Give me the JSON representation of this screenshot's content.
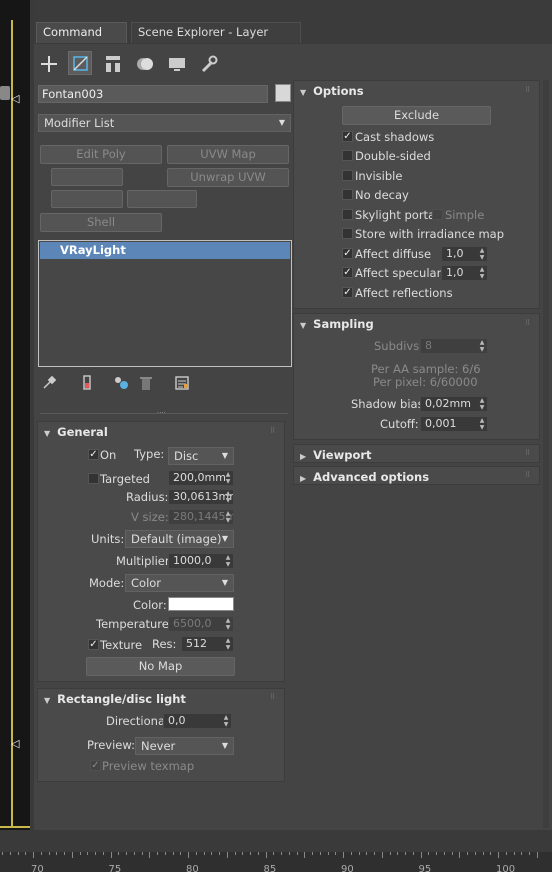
{
  "tabs": [
    {
      "label": "Command Panel"
    },
    {
      "label": "Scene Explorer - Layer Explorer"
    }
  ],
  "object": {
    "name": "Fontan003"
  },
  "modifier_list": {
    "value": "Modifier List"
  },
  "modifier_buttons": {
    "edit_poly": "Edit Poly",
    "uvw_map": "UVW Map",
    "unwrap_uvw": "Unwrap UVW",
    "shell": "Shell"
  },
  "stack": {
    "items": [
      {
        "label": "VRayLight"
      }
    ]
  },
  "general": {
    "title": "General",
    "on_label": "On",
    "type_label": "Type:",
    "type_value": "Disc",
    "targeted_label": "Targeted",
    "targeted_value": "200,0mm",
    "radius_label": "Radius:",
    "radius_value": "30,0613mm",
    "vsize_label": "V size:",
    "vsize_value": "280,1445mm",
    "units_label": "Units:",
    "units_value": "Default (image)",
    "multiplier_label": "Multiplier:",
    "multiplier_value": "1000,0",
    "mode_label": "Mode:",
    "mode_value": "Color",
    "color_label": "Color:",
    "color_swatch": "#ffffff",
    "temperature_label": "Temperature:",
    "temperature_value": "6500,0",
    "texture_label": "Texture",
    "res_label": "Res:",
    "res_value": "512",
    "nomap_label": "No Map"
  },
  "rect_disc": {
    "title": "Rectangle/disc light",
    "directional_label": "Directional:",
    "directional_value": "0,0",
    "preview_label": "Preview:",
    "preview_value": "Never",
    "preview_texmap_label": "Preview texmap"
  },
  "options": {
    "title": "Options",
    "exclude_label": "Exclude",
    "cast_shadows": "Cast shadows",
    "double_sided": "Double-sided",
    "invisible": "Invisible",
    "no_decay": "No decay",
    "skylight_portal": "Skylight portal",
    "simple": "Simple",
    "store_irradiance": "Store with irradiance map",
    "affect_diffuse": "Affect diffuse",
    "affect_diffuse_value": "1,0",
    "affect_specular": "Affect specular",
    "affect_specular_value": "1,0",
    "affect_reflections": "Affect reflections"
  },
  "sampling": {
    "title": "Sampling",
    "subdivs_label": "Subdivs:",
    "subdivs_value": "8",
    "per_aa": "Per AA sample: 6/6",
    "per_pixel": "Per pixel: 6/60000",
    "shadow_bias_label": "Shadow bias:",
    "shadow_bias_value": "0,02mm",
    "cutoff_label": "Cutoff:",
    "cutoff_value": "0,001"
  },
  "viewport": {
    "title": "Viewport"
  },
  "advanced": {
    "title": "Advanced options"
  },
  "ruler": {
    "ticks": [
      "70",
      "75",
      "80",
      "85",
      "90",
      "95",
      "100"
    ]
  }
}
